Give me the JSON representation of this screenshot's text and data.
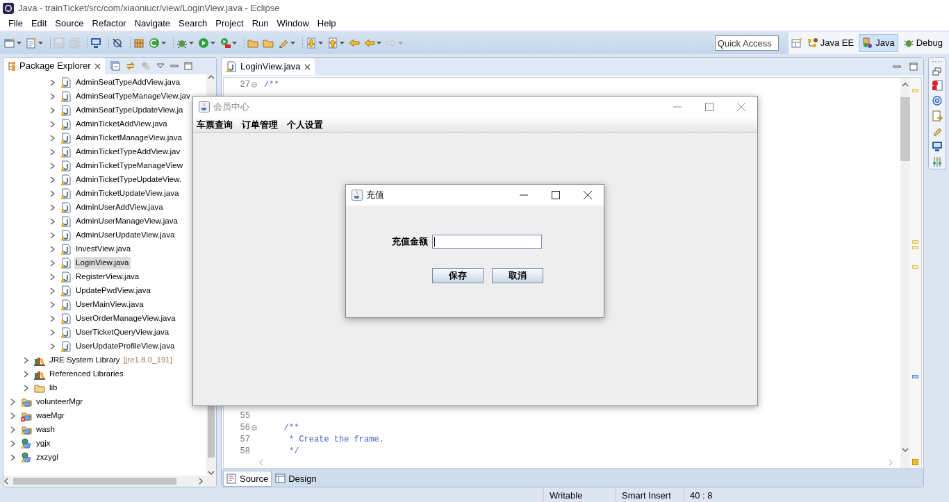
{
  "window": {
    "title": "Java - trainTicket/src/com/xiaoniucr/view/LoginView.java - Eclipse"
  },
  "menu": [
    "File",
    "Edit",
    "Source",
    "Refactor",
    "Navigate",
    "Search",
    "Project",
    "Run",
    "Window",
    "Help"
  ],
  "toolbar": [
    {
      "kind": "new-window",
      "caret": true,
      "disabled": false
    },
    {
      "kind": "new-document",
      "caret": true,
      "disabled": false
    },
    {
      "kind": "separator"
    },
    {
      "kind": "save",
      "caret": false,
      "disabled": true
    },
    {
      "kind": "save-all",
      "caret": false,
      "disabled": true
    },
    {
      "kind": "separator"
    },
    {
      "kind": "monitor",
      "caret": false,
      "disabled": false
    },
    {
      "kind": "separator"
    },
    {
      "kind": "slashed",
      "caret": false,
      "disabled": false
    },
    {
      "kind": "separator"
    },
    {
      "kind": "grid",
      "caret": false,
      "disabled": false
    },
    {
      "kind": "refresh",
      "caret": true,
      "disabled": false
    },
    {
      "kind": "separator"
    },
    {
      "kind": "bug",
      "caret": true,
      "disabled": false
    },
    {
      "kind": "play",
      "caret": true,
      "disabled": false
    },
    {
      "kind": "tools",
      "caret": true,
      "disabled": false
    },
    {
      "kind": "separator"
    },
    {
      "kind": "folder",
      "caret": false,
      "disabled": false
    },
    {
      "kind": "folder",
      "caret": false,
      "disabled": false
    },
    {
      "kind": "pen",
      "caret": true,
      "disabled": false
    },
    {
      "kind": "separator"
    },
    {
      "kind": "down-arrow",
      "caret": true,
      "disabled": false
    },
    {
      "kind": "up-arrow",
      "caret": true,
      "disabled": false
    },
    {
      "kind": "left-arrow",
      "caret": false,
      "disabled": false
    },
    {
      "kind": "left-arrow",
      "caret": true,
      "disabled": false
    },
    {
      "kind": "right-arrow",
      "caret": true,
      "disabled": true
    }
  ],
  "quick_access": {
    "placeholder": "Quick Access"
  },
  "perspectives": [
    {
      "label": "Java EE",
      "kind": "javaee",
      "selected": false
    },
    {
      "label": "Java",
      "kind": "java",
      "selected": true
    },
    {
      "label": "Debug",
      "kind": "debug",
      "selected": false
    }
  ],
  "package_explorer": {
    "title": "Package Explorer",
    "package_files": [
      {
        "label": "AdminSeatTypeAddView.java",
        "selected": false,
        "expanded": false
      },
      {
        "label": "AdminSeatTypeManageView.jav",
        "selected": false,
        "expanded": false
      },
      {
        "label": "AdminSeatTypeUpdateView.ja",
        "selected": false,
        "expanded": false
      },
      {
        "label": "AdminTicketAddView.java",
        "selected": false,
        "expanded": false
      },
      {
        "label": "AdminTicketManageView.java",
        "selected": false,
        "expanded": false
      },
      {
        "label": "AdminTicketTypeAddView.jav",
        "selected": false,
        "expanded": false
      },
      {
        "label": "AdminTicketTypeManageView",
        "selected": false,
        "expanded": false
      },
      {
        "label": "AdminTicketTypeUpdateView.",
        "selected": false,
        "expanded": false
      },
      {
        "label": "AdminTicketUpdateView.java",
        "selected": false,
        "expanded": false
      },
      {
        "label": "AdminUserAddView.java",
        "selected": false,
        "expanded": false
      },
      {
        "label": "AdminUserManageView.java",
        "selected": false,
        "expanded": false
      },
      {
        "label": "AdminUserUpdateView.java",
        "selected": false,
        "expanded": false
      },
      {
        "label": "InvestView.java",
        "selected": false,
        "expanded": false
      },
      {
        "label": "LoginView.java",
        "selected": true,
        "expanded": false
      },
      {
        "label": "RegisterView.java",
        "selected": false,
        "expanded": false
      },
      {
        "label": "UpdatePwdView.java",
        "selected": false,
        "expanded": false
      },
      {
        "label": "UserMainView.java",
        "selected": false,
        "expanded": false
      },
      {
        "label": "UserOrderManageView.java",
        "selected": false,
        "expanded": false
      },
      {
        "label": "UserTicketQueryView.java",
        "selected": false,
        "expanded": false
      },
      {
        "label": "UserUpdateProfileView.java",
        "selected": false,
        "expanded": false
      }
    ],
    "project_entries": [
      {
        "label": "JRE System Library",
        "suffix": "[jre1.8.0_191]",
        "kind": "library",
        "selected": false,
        "expanded": false
      },
      {
        "label": "Referenced Libraries",
        "kind": "library",
        "selected": false,
        "expanded": false
      },
      {
        "label": "lib",
        "kind": "folder",
        "selected": false,
        "expanded": false
      }
    ],
    "projects": [
      {
        "label": "volunteerMgr",
        "kind": "project",
        "selected": false,
        "expanded": false
      },
      {
        "label": "waeMgr",
        "kind": "project-error",
        "selected": false,
        "expanded": false
      },
      {
        "label": "wash",
        "kind": "project",
        "selected": false,
        "expanded": false
      },
      {
        "label": "ygjx",
        "kind": "web-project",
        "selected": false,
        "expanded": false
      },
      {
        "label": "zxzygl",
        "kind": "web-project",
        "selected": false,
        "expanded": false
      }
    ]
  },
  "editor": {
    "tabs": [
      {
        "label": "LoginView.java",
        "selected": true
      }
    ],
    "top_lines": [
      {
        "number": "27",
        "text": "/**",
        "fold": true
      }
    ],
    "bottom_lines": [
      {
        "number": "55",
        "fold": false
      },
      {
        "number": "56",
        "text": "    /**",
        "fold": true
      },
      {
        "number": "57",
        "text": "     * Create the frame.",
        "fold": false
      },
      {
        "number": "58",
        "text": "     */",
        "fold": false
      }
    ],
    "bottom_tabs": [
      {
        "label": "Source",
        "selected": true
      },
      {
        "label": "Design",
        "selected": false
      }
    ]
  },
  "status_bar": [
    "Writable",
    "Smart Insert",
    "40 : 8"
  ],
  "frame": {
    "title": "会员中心",
    "active": false,
    "menu": [
      "车票查询",
      "订单管理",
      "个人设置"
    ]
  },
  "dialog": {
    "title": "充值",
    "active": true,
    "field_label": "充值金额",
    "buttons": [
      "保存",
      "取消"
    ]
  }
}
